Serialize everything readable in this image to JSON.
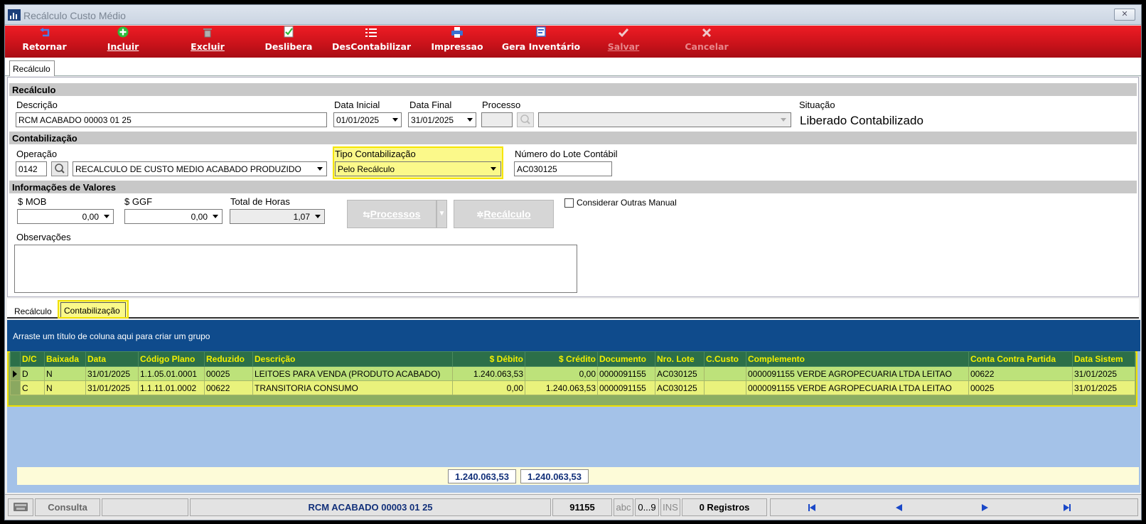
{
  "window": {
    "title": "Recálculo Custo Médio",
    "close_glyph": "✕"
  },
  "toolbar": {
    "retornar": "Retornar",
    "incluir": "Incluir",
    "excluir": "Excluir",
    "deslibera": "Deslibera",
    "descontabilizar": "DesContabilizar",
    "impressao": "Impressao",
    "gera_inventario": "Gera Inventário",
    "salvar": "Salvar",
    "cancelar": "Cancelar"
  },
  "tabs_top": {
    "recalculo": "Recálculo"
  },
  "sections": {
    "recalculo": "Recálculo",
    "contabilizacao": "Contabilização",
    "informacoes": "Informações de Valores"
  },
  "form": {
    "descricao_label": "Descrição",
    "descricao_value": "RCM ACABADO 00003 01 25",
    "data_inicial_label": "Data Inicial",
    "data_inicial_value": "01/01/2025",
    "data_final_label": "Data Final",
    "data_final_value": "31/01/2025",
    "processo_label": "Processo",
    "processo_code": "",
    "processo_value": "",
    "situacao_label": "Situação",
    "situacao_value": "Liberado Contabilizado",
    "operacao_label": "Operação",
    "operacao_code": "0142",
    "operacao_value": "RECALCULO DE CUSTO MEDIO ACABADO PRODUZIDO",
    "tipo_contab_label": "Tipo Contabilização",
    "tipo_contab_value": "Pelo Recálculo",
    "lote_label": "Número do Lote Contábil",
    "lote_value": "AC030125",
    "mob_label": "$ MOB",
    "mob_value": "0,00",
    "ggf_label": "$ GGF",
    "ggf_value": "0,00",
    "horas_label": "Total de Horas",
    "horas_value": "1,07",
    "btn_processos": "Processos",
    "btn_recalculo": "Recálculo",
    "considerar_label": "Considerar Outras Manual",
    "observacoes_label": "Observações",
    "observacoes_value": ""
  },
  "tabs_bottom": {
    "recalculo": "Recálculo",
    "contabilizacao": "Contabilização"
  },
  "grid": {
    "group_hint": "Arraste um título de coluna aqui para criar um grupo",
    "columns": [
      "D/C",
      "Baixada",
      "Data",
      "Código Plano",
      "Reduzido",
      "Descrição",
      "$ Débito",
      "$ Crédito",
      "Documento",
      "Nro. Lote",
      "C.Custo",
      "Complemento",
      "Conta Contra Partida",
      "Data Sistem"
    ],
    "rows": [
      [
        "D",
        "N",
        "31/01/2025",
        "1.1.05.01.0001",
        "00025",
        "LEITOES PARA VENDA (PRODUTO ACABADO)",
        "1.240.063,53",
        "0,00",
        "0000091155",
        "AC030125",
        "",
        "0000091155 VERDE AGROPECUARIA LTDA LEITAO",
        "00622",
        "31/01/2025"
      ],
      [
        "C",
        "N",
        "31/01/2025",
        "1.1.11.01.0002",
        "00622",
        "TRANSITORIA CONSUMO",
        "0,00",
        "1.240.063,53",
        "0000091155",
        "AC030125",
        "",
        "0000091155 VERDE AGROPECUARIA LTDA LEITAO",
        "00025",
        "31/01/2025"
      ]
    ],
    "total_debito": "1.240.063,53",
    "total_credito": "1.240.063,53"
  },
  "status": {
    "mode": "Consulta",
    "record": "RCM ACABADO 00003 01 25",
    "id": "91155",
    "abc": "abc",
    "num": "0...9",
    "ins": "INS",
    "registros": "0 Registros"
  },
  "colors": {
    "toolbar_red": "#d4141c",
    "grid_header": "#2c6f49",
    "highlight": "#f6e500",
    "group_bar": "#0f4b8c"
  }
}
